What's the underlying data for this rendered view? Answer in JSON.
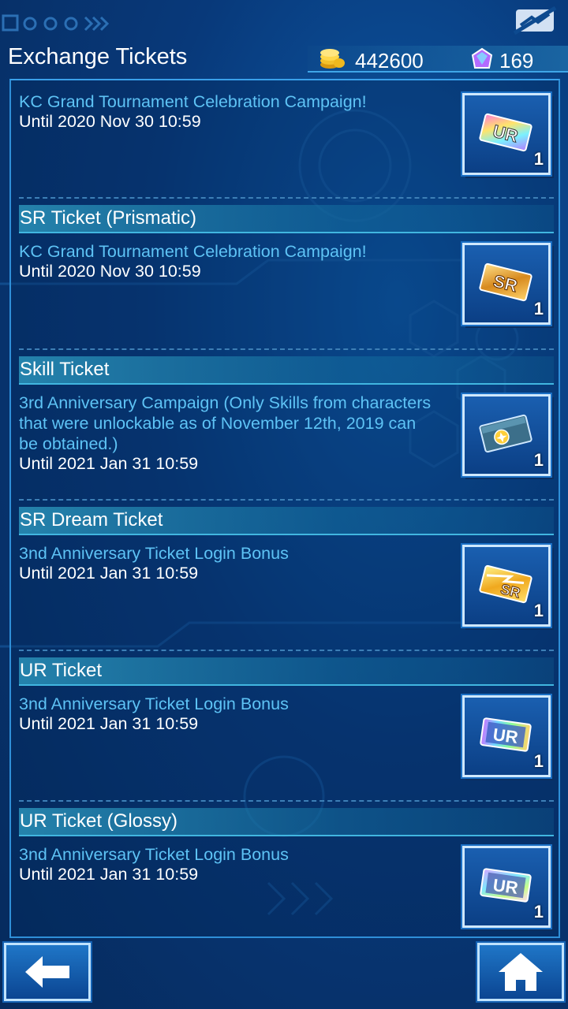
{
  "header": {
    "title": "Exchange Tickets",
    "gold": "442600",
    "gems": "169",
    "signal_icon": "signal-off-icon"
  },
  "entries": [
    {
      "heading": "",
      "campaign": "KC Grand Tournament Celebration Campaign!",
      "until": "Until 2020 Nov 30 10:59",
      "ticket": {
        "type": "UR",
        "icon": "ur-ticket-prismatic-icon",
        "qty": "1"
      }
    },
    {
      "heading": "SR Ticket (Prismatic)",
      "campaign": "KC Grand Tournament Celebration Campaign!",
      "until": "Until 2020 Nov 30 10:59",
      "ticket": {
        "type": "SR",
        "icon": "sr-ticket-prismatic-icon",
        "qty": "1"
      }
    },
    {
      "heading": "Skill Ticket",
      "campaign": "3rd Anniversary Campaign (Only Skills from characters that were unlockable as of November 12th, 2019 can be obtained.)",
      "until": "Until 2021 Jan 31 10:59",
      "ticket": {
        "type": "Skill",
        "icon": "skill-ticket-icon",
        "qty": "1"
      }
    },
    {
      "heading": "SR Dream Ticket",
      "campaign": "3nd Anniversary Ticket Login Bonus",
      "until": "Until 2021 Jan 31 10:59",
      "ticket": {
        "type": "SR",
        "icon": "sr-dream-ticket-icon",
        "qty": "1"
      }
    },
    {
      "heading": "UR Ticket",
      "campaign": "3nd Anniversary Ticket Login Bonus",
      "until": "Until 2021 Jan 31 10:59",
      "ticket": {
        "type": "UR",
        "icon": "ur-ticket-icon",
        "qty": "1"
      }
    },
    {
      "heading": "UR Ticket (Glossy)",
      "campaign": "3nd Anniversary Ticket Login Bonus",
      "until": "Until 2021 Jan 31 10:59",
      "ticket": {
        "type": "UR",
        "icon": "ur-ticket-glossy-icon",
        "qty": "1"
      }
    }
  ],
  "footer": {
    "back_icon": "arrow-left-icon",
    "home_icon": "home-icon"
  },
  "colors": {
    "accent": "#3fa6e8",
    "campaign_text": "#5ec3f5",
    "background": "#08397a"
  }
}
